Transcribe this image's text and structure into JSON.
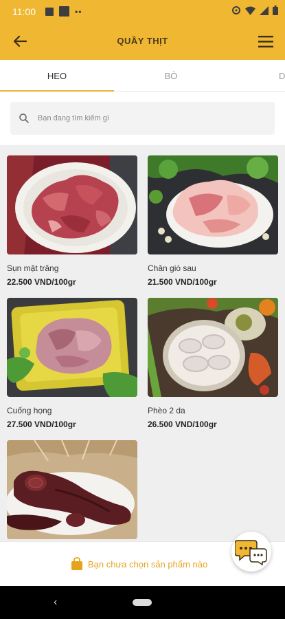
{
  "status_bar": {
    "time": "11:00"
  },
  "header": {
    "title": "QUẦY THỊT"
  },
  "tabs": [
    {
      "label": "HEO",
      "active": true
    },
    {
      "label": "BÒ",
      "active": false
    },
    {
      "label": "D",
      "active": false
    }
  ],
  "search": {
    "placeholder": "Bạn đang tìm kiếm gì",
    "value": ""
  },
  "products": [
    {
      "name": "Sụn mặt trăng",
      "price": "22.500 VND/100gr",
      "image": "pork-cartilage-photo"
    },
    {
      "name": "Chân giò sau",
      "price": "21.500 VND/100gr",
      "image": "pork-hock-photo"
    },
    {
      "name": "Cuống họng",
      "price": "27.500 VND/100gr",
      "image": "pork-throat-photo"
    },
    {
      "name": "Phèo 2 da",
      "price": "26.500 VND/100gr",
      "image": "pork-intestine-photo"
    },
    {
      "name": "",
      "price": "",
      "image": "blood-sausage-photo"
    }
  ],
  "cart": {
    "message": "Bạn chưa chọn sản phẩm nào"
  },
  "colors": {
    "primary": "#f0b732",
    "cart_text": "#e6a31c",
    "tab_indicator": "#f0b732"
  }
}
